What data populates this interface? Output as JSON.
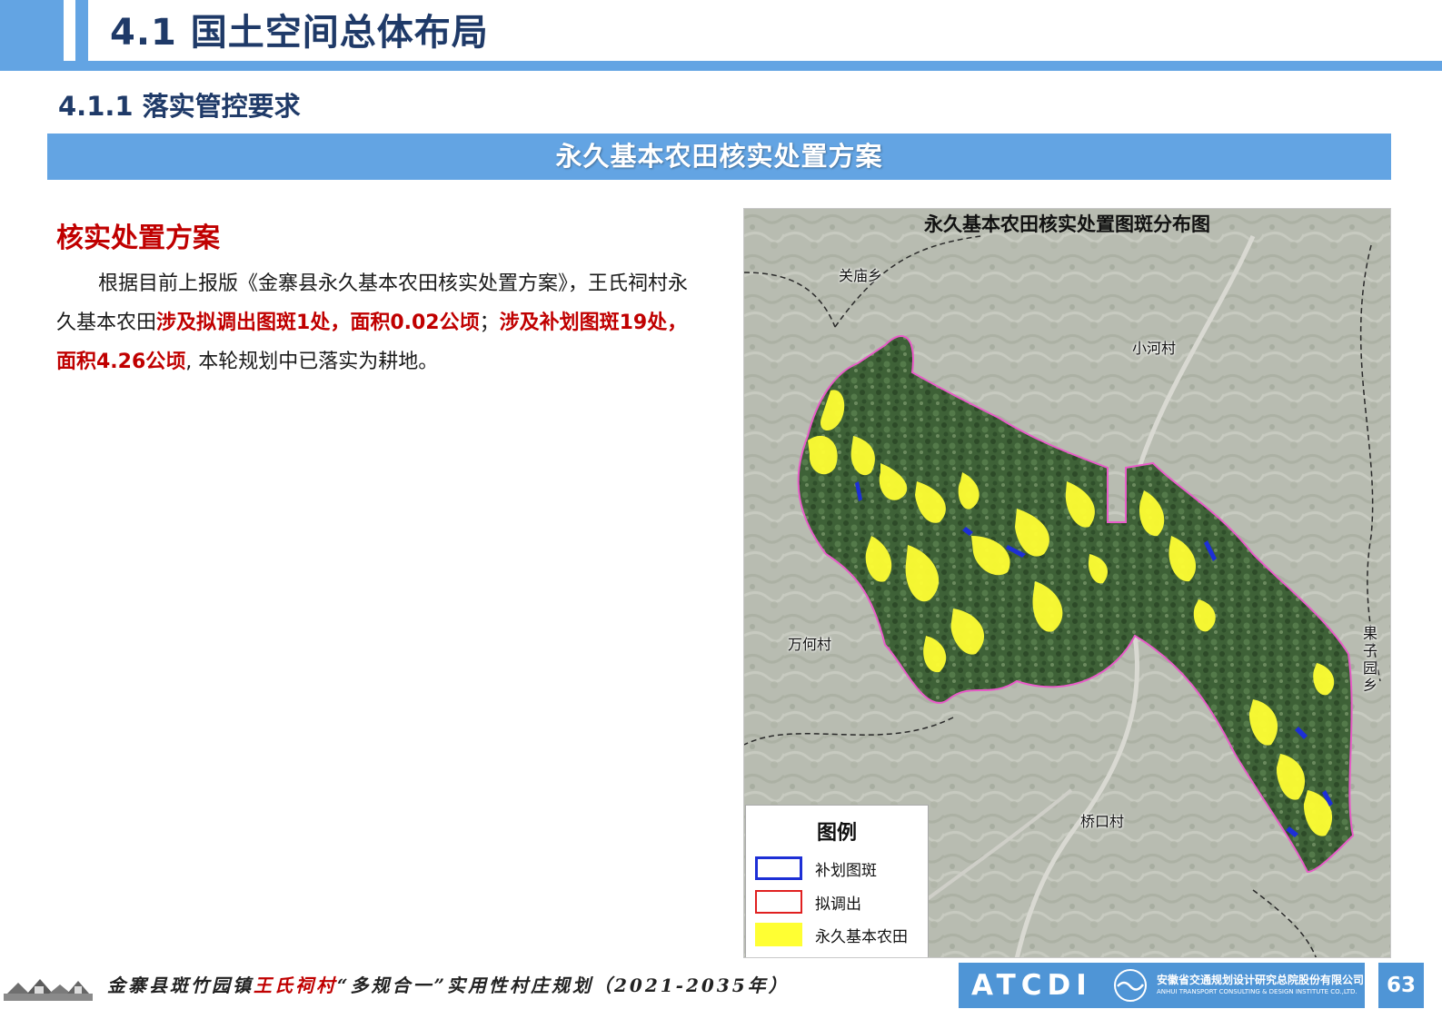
{
  "header": {
    "title": "4.1 国土空间总体布局",
    "subtitle": "4.1.1 落实管控要求"
  },
  "banner": "永久基本农田核实处置方案",
  "section": {
    "heading": "核实处置方案",
    "paragraph": {
      "p1": "根据目前上报版《金寨县永久基本农田核实处置方案》，王氏祠村永久基本农田",
      "p2": "涉及拟调出图斑1处，面积0.02公顷",
      "p3": "；",
      "p4": "涉及补划图斑19处，面积4.26公顷",
      "p5": ", 本轮规划中已落实为耕地。"
    }
  },
  "map": {
    "title": "永久基本农田核实处置图斑分布图",
    "places": {
      "guanmiao": "关庙乡",
      "xiaohe": "小河村",
      "wanhe": "万何村",
      "qiaokou": "桥口村",
      "guoziyuan": "果子园乡"
    },
    "legend": {
      "title": "图例",
      "items": [
        {
          "label": "补划图斑",
          "color": "#1d2fd6"
        },
        {
          "label": "拟调出",
          "color": "#e02020"
        },
        {
          "label": "永久基本农田",
          "color": "#ffff33"
        }
      ]
    },
    "colors": {
      "village_boundary": "#e85cc8",
      "basic_farmland": "#ffff33",
      "supplement": "#1d2fd6"
    }
  },
  "footer": {
    "text_a": "金寨县斑竹园镇",
    "text_b": "王氏祠村",
    "text_c": "“多规合一”实用性村庄规划（2021-2035年）",
    "brand": "ATCDI",
    "company_cn": "安徽省交通规划设计研究总院股份有限公司",
    "company_en": "ANHUI TRANSPORT CONSULTING & DESIGN INSTITUTE CO.,LTD.",
    "page": "63"
  }
}
